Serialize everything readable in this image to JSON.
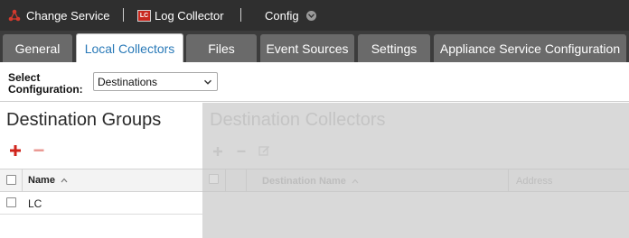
{
  "topbar": {
    "change_service": "Change Service",
    "log_collector": "Log Collector",
    "lc_badge": "LC",
    "config": "Config"
  },
  "tabs": [
    {
      "label": "General"
    },
    {
      "label": "Local Collectors",
      "active": true
    },
    {
      "label": "Files"
    },
    {
      "label": "Event Sources"
    },
    {
      "label": "Settings"
    },
    {
      "label": "Appliance Service Configuration"
    }
  ],
  "config": {
    "label_line1": "Select",
    "label_line2": "Configuration:",
    "selected": "Destinations"
  },
  "left_panel": {
    "title": "Destination Groups",
    "columns": [
      "Name"
    ],
    "rows": [
      {
        "name": "LC"
      }
    ]
  },
  "right_panel": {
    "title": "Destination Collectors",
    "columns": [
      "Destination Name",
      "Address"
    ]
  },
  "colors": {
    "topbar": "#2f2f2f",
    "tabbar": "#3c3c3c",
    "tab_inactive": "#6a6a6a",
    "active_tab_text": "#2a7ab8",
    "accent_red": "#c8281e",
    "disabled_bg": "#d9d9d9"
  }
}
